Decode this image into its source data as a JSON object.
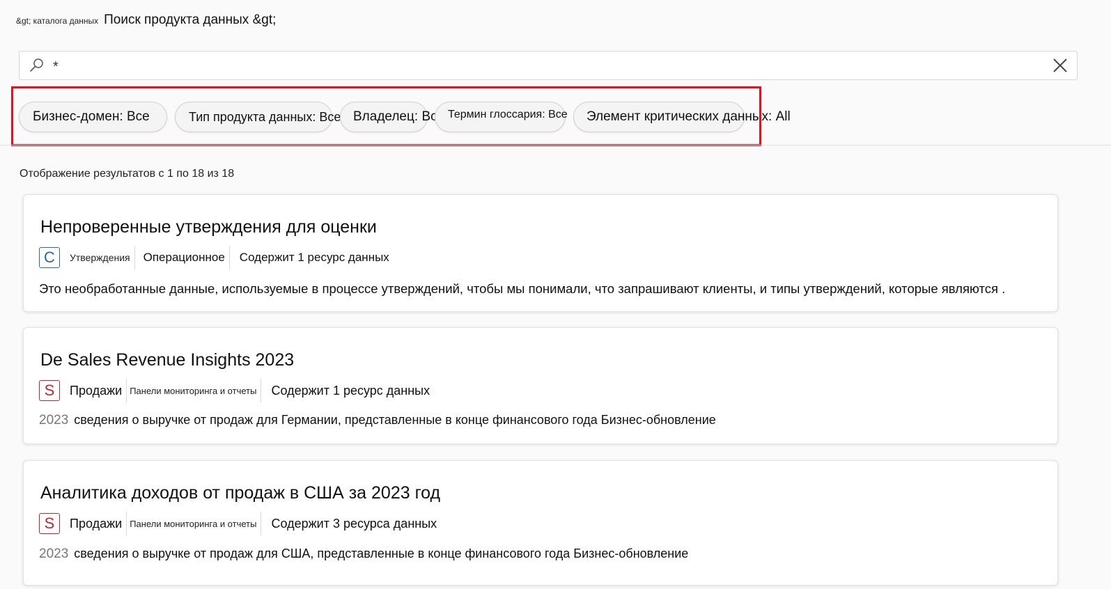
{
  "breadcrumb": {
    "catalog": "&gt; каталога данных",
    "current": "Поиск продукта данных &gt;"
  },
  "search": {
    "value": "*"
  },
  "filters": [
    {
      "label": "Бизнес-домен: Все"
    },
    {
      "label": "Тип продукта данных: Все"
    },
    {
      "label": "Владелец: Все"
    },
    {
      "label": "Термин глоссария: Все"
    },
    {
      "label": "Элемент критических данных: All"
    }
  ],
  "results_count": "Отображение результатов с 1 по 18 из 18",
  "cards": [
    {
      "title": "Непроверенные утверждения для оценки",
      "badge_letter": "C",
      "badge_color": "#2b6a9e",
      "domain": "Утверждения",
      "type": "Операционное",
      "contains": "Содержит 1 ресурс данных",
      "year": "",
      "description": "Это необработанные данные, используемые в процессе утверждений, чтобы мы понимали, что запрашивают клиенты, и типы утверждений, которые являются ."
    },
    {
      "title": "De Sales Revenue Insights 2023",
      "badge_letter": "S",
      "badge_color": "#c4262e",
      "domain": "Продажи",
      "type": "Панели мониторинга и отчеты",
      "contains": "Содержит 1 ресурс данных",
      "year": "2023",
      "description": "сведения о выручке от продаж для Германии, представленные в конце финансового года Бизнес-обновление"
    },
    {
      "title": "Аналитика доходов от продаж в США за 2023 год",
      "badge_letter": "S",
      "badge_color": "#c4262e",
      "domain": "Продажи",
      "type": "Панели мониторинга и отчеты",
      "contains": "Содержит 3 ресурса данных",
      "year": "2023",
      "description": "сведения о выручке от продаж для США, представленные в конце финансового года Бизнес-обновление"
    }
  ]
}
